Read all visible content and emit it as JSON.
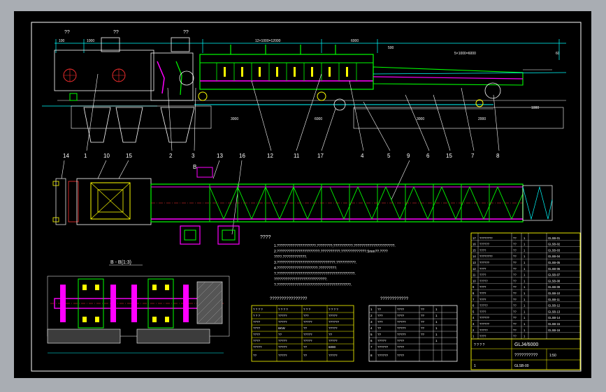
{
  "colors": {
    "background": "#a9adb3",
    "canvas": "#000000",
    "frame": "#ffffff",
    "cyan": "#00ffff",
    "green": "#00ff00",
    "magenta": "#ff00ff",
    "yellow": "#ffff00",
    "red": "#ff3030",
    "white": "#ffffff"
  },
  "drawing": {
    "main_view": {
      "top_labels": [
        "??",
        "??",
        "??"
      ],
      "dimensions": [
        "100",
        "1000",
        "12×1000=12000",
        "6000",
        "500",
        "5×1000=6000",
        "60"
      ],
      "lower_dims": [
        "3000",
        "6000",
        "3000",
        "2000",
        "1000"
      ],
      "part_callouts": [
        "1",
        "2",
        "3",
        "12",
        "11",
        "17",
        "4",
        "5",
        "6",
        "15",
        "7",
        "8"
      ]
    },
    "plan_view": {
      "callouts": [
        "14",
        "10",
        "15",
        "13",
        "16",
        "9"
      ],
      "section_mark": "B"
    },
    "section_view": {
      "title": "B - B(1:3)"
    },
    "notes": {
      "heading": "????",
      "lines": [
        "1.????????????????????.????????;??????????.?????????????????????.",
        "2.??????????????????????.??????????.?????????????.5mm??.????",
        "  ????.????????????.",
        "3.??????????????????????????????.??????????.",
        "4.?????????????????????.?????????.",
        "  ?.????????????????????????????????????????.",
        "  ???????????????????????????.",
        "  ?.??????????????????????????????????????."
      ]
    },
    "spec_table": {
      "title": "????????????????",
      "headers": [
        "?  ?  ?  ?",
        "?  ?  ?  ?",
        "?  ?  ?",
        "?  ?  ?  ?"
      ],
      "rows": [
        [
          "?  ?  ?",
          "?????",
          "???",
          "?????"
        ],
        [
          "????",
          "?????",
          "?????",
          "??????"
        ],
        [
          "????",
          "6KW",
          "??",
          "?????"
        ],
        [
          "????",
          "??",
          "?????",
          "??"
        ],
        [
          "????",
          "?????",
          "?????",
          "?????"
        ],
        [
          "?????",
          "?????",
          "??",
          "6000"
        ],
        [
          "??",
          "?????",
          "??",
          "?????"
        ]
      ]
    },
    "motor_table": {
      "title": "????????????",
      "rows": [
        [
          "1",
          "??",
          "????",
          "??",
          "1",
          ""
        ],
        [
          "2",
          "???",
          "????",
          "??",
          "1",
          ""
        ],
        [
          "3",
          "???",
          "?????",
          "??",
          "1",
          ""
        ],
        [
          "4",
          "??",
          "?????",
          "??",
          "1",
          ""
        ],
        [
          "5",
          "??",
          "?????",
          "??",
          "1",
          ""
        ],
        [
          "6",
          "?????",
          "????",
          "",
          "1",
          ""
        ],
        [
          "7",
          "??????",
          "????",
          "",
          "",
          ""
        ],
        [
          "8",
          "??????",
          "????",
          "",
          "",
          ""
        ]
      ]
    },
    "bom": {
      "items": [
        [
          "17",
          "????????",
          "??",
          "1"
        ],
        [
          "16",
          "??????",
          "??",
          "1"
        ],
        [
          "15",
          "????",
          "??",
          "1"
        ],
        [
          "14",
          "????????",
          "??",
          "1"
        ],
        [
          "13",
          "??????",
          "??",
          "1"
        ],
        [
          "12",
          "????",
          "??",
          "1"
        ],
        [
          "11",
          "????",
          "??",
          "1"
        ],
        [
          "10",
          "?????",
          "??",
          "1"
        ],
        [
          "9",
          "????",
          "??",
          "1"
        ],
        [
          "8",
          "????",
          "??",
          "1"
        ],
        [
          "7",
          "????",
          "??",
          "1"
        ],
        [
          "6",
          "?????",
          "??",
          "1"
        ],
        [
          "5",
          "????",
          "??",
          "1"
        ],
        [
          "4",
          "??????",
          "??",
          "1"
        ],
        [
          "3",
          "??????",
          "??",
          "1"
        ],
        [
          "2",
          "?????",
          "??",
          "1"
        ],
        [
          "1",
          "????",
          "??",
          "1"
        ]
      ],
      "codes": [
        "GLSB-01",
        "GLSB-02",
        "GLSB-03",
        "GLSB-04",
        "GLSB-05",
        "GLSB-06",
        "GLSB-07",
        "GLSB-08",
        "GLSB-09",
        "GLSB-10",
        "GLSB-11",
        "GLSB-12",
        "GLSB-13",
        "GLSB-14",
        "GLSB-15",
        "GLSB-16"
      ],
      "header": [
        "?",
        "?  ?  ?  ?",
        "?",
        "?"
      ]
    },
    "title_block": {
      "drawing_number": "GLJ4/6000",
      "name": "??????????",
      "code": "GLSB-00",
      "scale": "1:50",
      "sheet": "1",
      "mark": "?  ?  ?  ?"
    }
  }
}
